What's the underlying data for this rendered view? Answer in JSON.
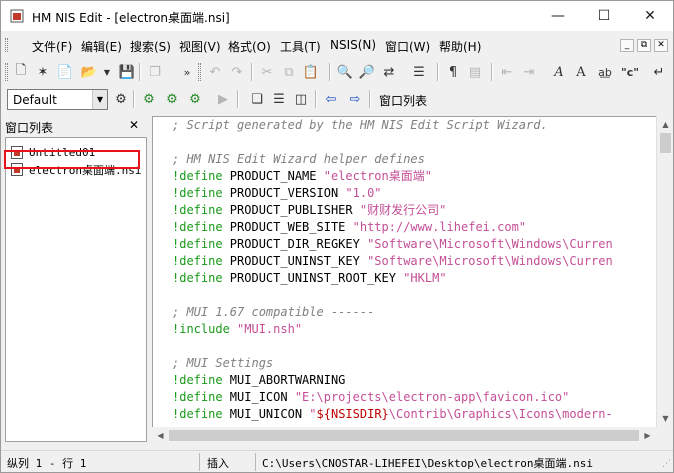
{
  "window": {
    "title": "HM NIS Edit - [electron桌面端.nsi]",
    "accent": "#ffffff"
  },
  "caption_buttons": {
    "minimize": "—",
    "maximize": "☐",
    "close": "✕"
  },
  "menu": {
    "items": [
      "文件(F)",
      "编辑(E)",
      "搜索(S)",
      "视图(V)",
      "格式(O)",
      "工具(T)",
      "NSIS(N)",
      "窗口(W)",
      "帮助(H)"
    ],
    "mdi": {
      "minimize": "_",
      "restore": "⧉",
      "close": "✕"
    }
  },
  "toolbar2": {
    "combo_value": "Default",
    "window_list_label": "窗口列表"
  },
  "panel": {
    "title": "窗口列表",
    "close": "✕",
    "files": [
      "Untitled01",
      "electron桌面端.nsi"
    ],
    "highlight_color": "#e8121b"
  },
  "editor": {
    "colors": {
      "comment": "#808080",
      "keyword": "#1a9a1a",
      "string": "#c44f96",
      "variable": "#c00000"
    },
    "lines": [
      {
        "comment": "; Script generated by the HM NIS Edit Script Wizard."
      },
      {
        "comment": ""
      },
      {
        "comment": "; HM NIS Edit Wizard helper defines"
      },
      {
        "kw": "!define",
        "id": " PRODUCT_NAME ",
        "str": "\"electron桌面端\""
      },
      {
        "kw": "!define",
        "id": " PRODUCT_VERSION ",
        "str": "\"1.0\""
      },
      {
        "kw": "!define",
        "id": " PRODUCT_PUBLISHER ",
        "str": "\"财财发行公司\""
      },
      {
        "kw": "!define",
        "id": " PRODUCT_WEB_SITE ",
        "str": "\"http://www.lihefei.com\""
      },
      {
        "kw": "!define",
        "id": " PRODUCT_DIR_REGKEY ",
        "str": "\"Software\\Microsoft\\Windows\\Curren"
      },
      {
        "kw": "!define",
        "id": " PRODUCT_UNINST_KEY ",
        "str": "\"Software\\Microsoft\\Windows\\Curren"
      },
      {
        "kw": "!define",
        "id": " PRODUCT_UNINST_ROOT_KEY ",
        "str": "\"HKLM\""
      },
      {
        "comment": ""
      },
      {
        "comment": "; MUI 1.67 compatible ------"
      },
      {
        "kw": "!include",
        "id": " ",
        "str": "\"MUI.nsh\""
      },
      {
        "comment": ""
      },
      {
        "comment": "; MUI Settings"
      },
      {
        "kw": "!define",
        "id": " MUI_ABORTWARNING"
      },
      {
        "kw": "!define",
        "id": " MUI_ICON ",
        "str": "\"E:\\projects\\electron-app\\favicon.ico\""
      },
      {
        "kw": "!define",
        "id": " MUI_UNICON ",
        "str": "\"",
        "var": "${NSISDIR}",
        "str2": "\\Contrib\\Graphics\\Icons\\modern-"
      }
    ]
  },
  "status": {
    "position": "纵列 1 - 行 1",
    "mode": "插入",
    "path": "C:\\Users\\CNOSTAR-LIHEFEI\\Desktop\\electron桌面端.nsi"
  }
}
